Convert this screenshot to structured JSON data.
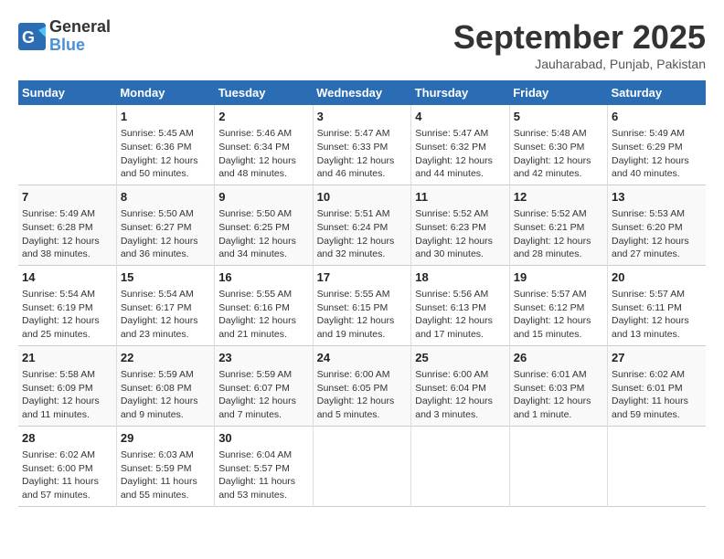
{
  "header": {
    "logo_line1": "General",
    "logo_line2": "Blue",
    "month_title": "September 2025",
    "location": "Jauharabad, Punjab, Pakistan"
  },
  "weekdays": [
    "Sunday",
    "Monday",
    "Tuesday",
    "Wednesday",
    "Thursday",
    "Friday",
    "Saturday"
  ],
  "weeks": [
    [
      {
        "day": "",
        "info": ""
      },
      {
        "day": "1",
        "info": "Sunrise: 5:45 AM\nSunset: 6:36 PM\nDaylight: 12 hours\nand 50 minutes."
      },
      {
        "day": "2",
        "info": "Sunrise: 5:46 AM\nSunset: 6:34 PM\nDaylight: 12 hours\nand 48 minutes."
      },
      {
        "day": "3",
        "info": "Sunrise: 5:47 AM\nSunset: 6:33 PM\nDaylight: 12 hours\nand 46 minutes."
      },
      {
        "day": "4",
        "info": "Sunrise: 5:47 AM\nSunset: 6:32 PM\nDaylight: 12 hours\nand 44 minutes."
      },
      {
        "day": "5",
        "info": "Sunrise: 5:48 AM\nSunset: 6:30 PM\nDaylight: 12 hours\nand 42 minutes."
      },
      {
        "day": "6",
        "info": "Sunrise: 5:49 AM\nSunset: 6:29 PM\nDaylight: 12 hours\nand 40 minutes."
      }
    ],
    [
      {
        "day": "7",
        "info": "Sunrise: 5:49 AM\nSunset: 6:28 PM\nDaylight: 12 hours\nand 38 minutes."
      },
      {
        "day": "8",
        "info": "Sunrise: 5:50 AM\nSunset: 6:27 PM\nDaylight: 12 hours\nand 36 minutes."
      },
      {
        "day": "9",
        "info": "Sunrise: 5:50 AM\nSunset: 6:25 PM\nDaylight: 12 hours\nand 34 minutes."
      },
      {
        "day": "10",
        "info": "Sunrise: 5:51 AM\nSunset: 6:24 PM\nDaylight: 12 hours\nand 32 minutes."
      },
      {
        "day": "11",
        "info": "Sunrise: 5:52 AM\nSunset: 6:23 PM\nDaylight: 12 hours\nand 30 minutes."
      },
      {
        "day": "12",
        "info": "Sunrise: 5:52 AM\nSunset: 6:21 PM\nDaylight: 12 hours\nand 28 minutes."
      },
      {
        "day": "13",
        "info": "Sunrise: 5:53 AM\nSunset: 6:20 PM\nDaylight: 12 hours\nand 27 minutes."
      }
    ],
    [
      {
        "day": "14",
        "info": "Sunrise: 5:54 AM\nSunset: 6:19 PM\nDaylight: 12 hours\nand 25 minutes."
      },
      {
        "day": "15",
        "info": "Sunrise: 5:54 AM\nSunset: 6:17 PM\nDaylight: 12 hours\nand 23 minutes."
      },
      {
        "day": "16",
        "info": "Sunrise: 5:55 AM\nSunset: 6:16 PM\nDaylight: 12 hours\nand 21 minutes."
      },
      {
        "day": "17",
        "info": "Sunrise: 5:55 AM\nSunset: 6:15 PM\nDaylight: 12 hours\nand 19 minutes."
      },
      {
        "day": "18",
        "info": "Sunrise: 5:56 AM\nSunset: 6:13 PM\nDaylight: 12 hours\nand 17 minutes."
      },
      {
        "day": "19",
        "info": "Sunrise: 5:57 AM\nSunset: 6:12 PM\nDaylight: 12 hours\nand 15 minutes."
      },
      {
        "day": "20",
        "info": "Sunrise: 5:57 AM\nSunset: 6:11 PM\nDaylight: 12 hours\nand 13 minutes."
      }
    ],
    [
      {
        "day": "21",
        "info": "Sunrise: 5:58 AM\nSunset: 6:09 PM\nDaylight: 12 hours\nand 11 minutes."
      },
      {
        "day": "22",
        "info": "Sunrise: 5:59 AM\nSunset: 6:08 PM\nDaylight: 12 hours\nand 9 minutes."
      },
      {
        "day": "23",
        "info": "Sunrise: 5:59 AM\nSunset: 6:07 PM\nDaylight: 12 hours\nand 7 minutes."
      },
      {
        "day": "24",
        "info": "Sunrise: 6:00 AM\nSunset: 6:05 PM\nDaylight: 12 hours\nand 5 minutes."
      },
      {
        "day": "25",
        "info": "Sunrise: 6:00 AM\nSunset: 6:04 PM\nDaylight: 12 hours\nand 3 minutes."
      },
      {
        "day": "26",
        "info": "Sunrise: 6:01 AM\nSunset: 6:03 PM\nDaylight: 12 hours\nand 1 minute."
      },
      {
        "day": "27",
        "info": "Sunrise: 6:02 AM\nSunset: 6:01 PM\nDaylight: 11 hours\nand 59 minutes."
      }
    ],
    [
      {
        "day": "28",
        "info": "Sunrise: 6:02 AM\nSunset: 6:00 PM\nDaylight: 11 hours\nand 57 minutes."
      },
      {
        "day": "29",
        "info": "Sunrise: 6:03 AM\nSunset: 5:59 PM\nDaylight: 11 hours\nand 55 minutes."
      },
      {
        "day": "30",
        "info": "Sunrise: 6:04 AM\nSunset: 5:57 PM\nDaylight: 11 hours\nand 53 minutes."
      },
      {
        "day": "",
        "info": ""
      },
      {
        "day": "",
        "info": ""
      },
      {
        "day": "",
        "info": ""
      },
      {
        "day": "",
        "info": ""
      }
    ]
  ]
}
